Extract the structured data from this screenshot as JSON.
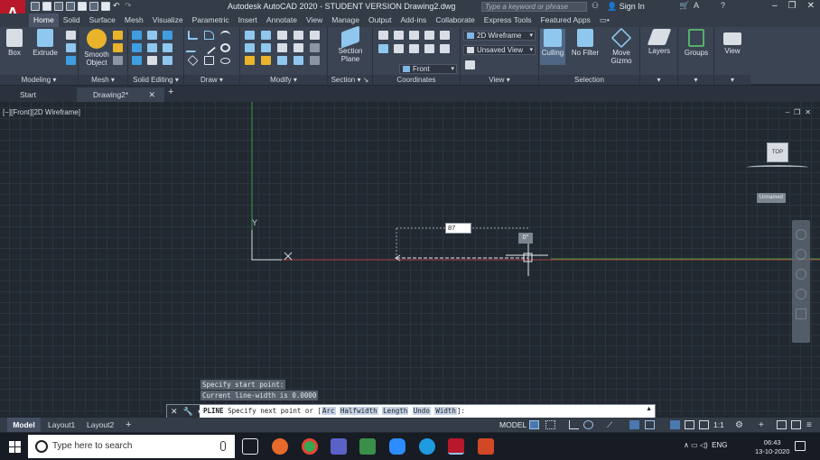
{
  "title_bar": {
    "title": "Autodesk AutoCAD 2020 - STUDENT VERSION    Drawing2.dwg",
    "app_letter": "A",
    "search_placeholder": "Type a keyword or phrase",
    "sign_in": "Sign In",
    "minimize": "‒",
    "restore": "❐",
    "close": "✕"
  },
  "ribbon_tabs": [
    "Home",
    "Solid",
    "Surface",
    "Mesh",
    "Visualize",
    "Parametric",
    "Insert",
    "Annotate",
    "View",
    "Manage",
    "Output",
    "Add-ins",
    "Collaborate",
    "Express Tools",
    "Featured Apps"
  ],
  "ribbon": {
    "panels": {
      "modeling": "Modeling",
      "mesh": "Mesh",
      "solid_editing": "Solid Editing",
      "draw": "Draw",
      "modify": "Modify",
      "section": "Section",
      "coordinates": "Coordinates",
      "view": "View",
      "selection": "Selection"
    },
    "buttons": {
      "box": "Box",
      "extrude": "Extrude",
      "smooth_line1": "Smooth",
      "smooth_line2": "Object",
      "section_line1": "Section",
      "section_line2": "Plane",
      "culling": "Culling",
      "no_filter": "No Filter",
      "move_line1": "Move",
      "move_line2": "Gizmo",
      "layers": "Layers",
      "groups": "Groups",
      "view": "View"
    },
    "dropdowns": {
      "visual_style": "2D Wireframe",
      "named_view": "Unsaved View",
      "view_direction": "Front"
    }
  },
  "file_tabs": {
    "start": "Start",
    "drawing": "Drawing2*",
    "close": "✕",
    "new": "+"
  },
  "viewport": {
    "label": "[−][Front][2D Wireframe]",
    "controls": [
      "‒",
      "❐",
      "✕"
    ],
    "viewcube_face": "TOP",
    "wcs": "Unnamed",
    "ucs_y": "Y",
    "dynamic_input": "87",
    "angle_tooltip": "0°"
  },
  "command": {
    "history": [
      "Specify start point:",
      "Current line-width is 0.0000"
    ],
    "cmd_name": "PLINE",
    "prompt_prefix": "Specify next point or [",
    "options": [
      "Arc",
      "Halfwidth",
      "Length",
      "Undo",
      "Width"
    ],
    "prompt_suffix": "]:"
  },
  "layout_tabs": [
    "Model",
    "Layout1",
    "Layout2"
  ],
  "layout_add": "+",
  "status": {
    "model": "MODEL",
    "scale": "1:1"
  },
  "taskbar": {
    "search_placeholder": "Type here to search",
    "language": "ENG",
    "time": "06:43",
    "date": "13-10-2020"
  },
  "colors": {
    "app_red": "#b8182a",
    "canvas": "#212830",
    "y_axis": "#3c9b42",
    "x_axis": "#a43b3b",
    "active_tab": "#4a5466"
  }
}
